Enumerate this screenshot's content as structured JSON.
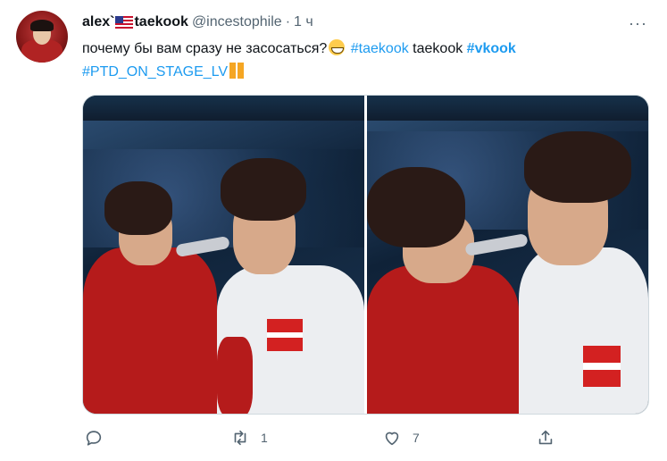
{
  "tweet": {
    "author_name_part1": "alex`",
    "author_name_part2": "taekook",
    "handle": "@incestophile",
    "separator": "·",
    "time": "1 ч",
    "text_main": "почему бы вам сразу не засосаться?",
    "tag_taekook": "#taekook",
    "plain_taekook": "taekook",
    "tag_vkook": "#vkook",
    "tag_ptd": "#PTD_ON_STAGE_LV",
    "more_label": "···"
  },
  "actions": {
    "reply_count": "",
    "retweet_count": "1",
    "like_count": "7",
    "share_count": ""
  },
  "icons": {
    "more": "more-dots-icon",
    "reply": "reply-bubble-icon",
    "retweet": "retweet-icon",
    "like": "heart-icon",
    "share": "share-icon",
    "flag": "us-flag-emoji",
    "grin": "grinning-sweat-emoji",
    "heart": "orange-heart-emoji"
  },
  "colors": {
    "link": "#1d9bf0",
    "muted": "#536471",
    "text": "#0f1419"
  }
}
